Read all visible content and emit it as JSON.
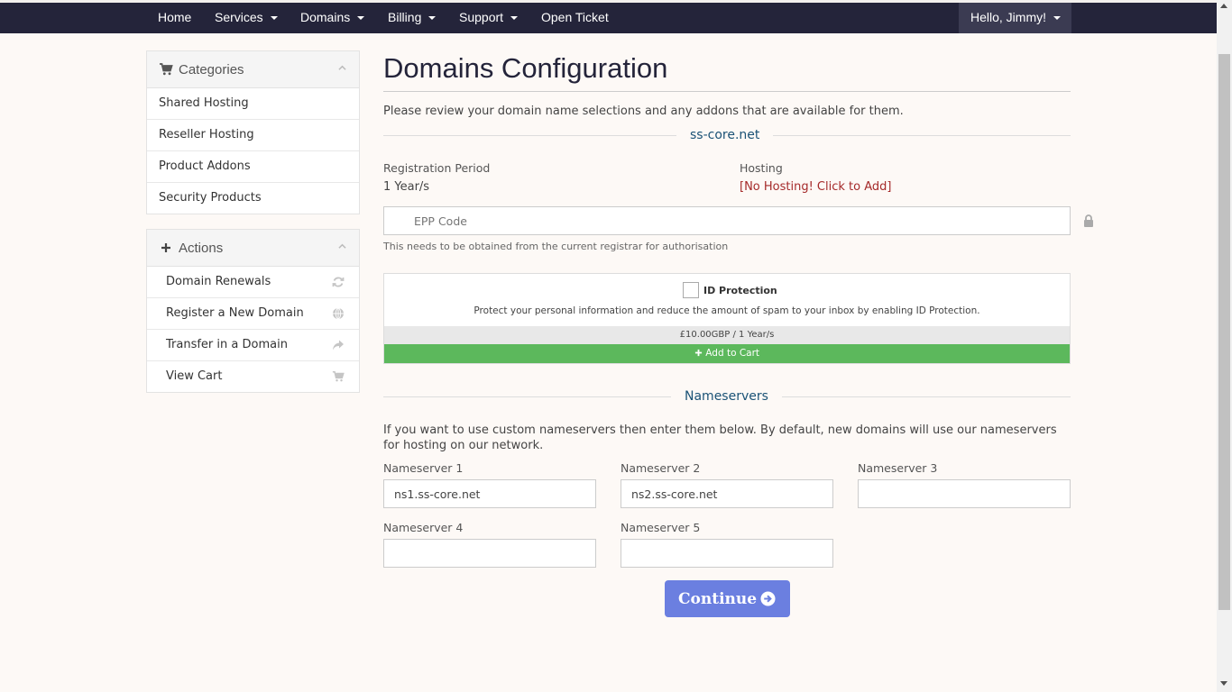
{
  "nav": {
    "items": [
      {
        "label": "Home",
        "caret": false
      },
      {
        "label": "Services",
        "caret": true
      },
      {
        "label": "Domains",
        "caret": true
      },
      {
        "label": "Billing",
        "caret": true
      },
      {
        "label": "Support",
        "caret": true
      },
      {
        "label": "Open Ticket",
        "caret": false
      }
    ],
    "user_label": "Hello, Jimmy!"
  },
  "sidebar": {
    "categories": {
      "title": "Categories",
      "icon": "cart-icon",
      "items": [
        "Shared Hosting",
        "Reseller Hosting",
        "Product Addons",
        "Security Products"
      ]
    },
    "actions": {
      "title": "Actions",
      "icon": "plus-icon",
      "items": [
        {
          "label": "Domain Renewals",
          "icon": "refresh-icon"
        },
        {
          "label": "Register a New Domain",
          "icon": "globe-icon"
        },
        {
          "label": "Transfer in a Domain",
          "icon": "share-arrow-icon"
        },
        {
          "label": "View Cart",
          "icon": "cart-icon"
        }
      ]
    }
  },
  "main": {
    "title": "Domains Configuration",
    "intro": "Please review your domain name selections and any addons that are available for them.",
    "domain": "ss-core.net",
    "registration_period_label": "Registration Period",
    "registration_period_value": "1 Year/s",
    "hosting_label": "Hosting",
    "hosting_link": "[No Hosting! Click to Add]",
    "epp_placeholder": "EPP Code",
    "epp_help": "This needs to be obtained from the current registrar for authorisation",
    "addon": {
      "name": "ID Protection",
      "description": "Protect your personal information and reduce the amount of spam to your inbox by enabling ID Protection.",
      "price": "£10.00GBP / 1 Year/s",
      "button": "Add to Cart"
    },
    "nameservers": {
      "heading": "Nameservers",
      "intro": "If you want to use custom nameservers then enter them below. By default, new domains will use our nameservers for hosting on our network.",
      "fields": [
        {
          "label": "Nameserver 1",
          "value": "ns1.ss-core.net"
        },
        {
          "label": "Nameserver 2",
          "value": "ns2.ss-core.net"
        },
        {
          "label": "Nameserver 3",
          "value": ""
        },
        {
          "label": "Nameserver 4",
          "value": ""
        },
        {
          "label": "Nameserver 5",
          "value": ""
        }
      ]
    },
    "continue_label": "Continue"
  },
  "colors": {
    "navbar": "#24243a",
    "accent": "#6b7fe0",
    "add_to_cart": "#5cb85c",
    "hosting_link": "#a52a2a",
    "page_bg": "#fdf9f6"
  }
}
